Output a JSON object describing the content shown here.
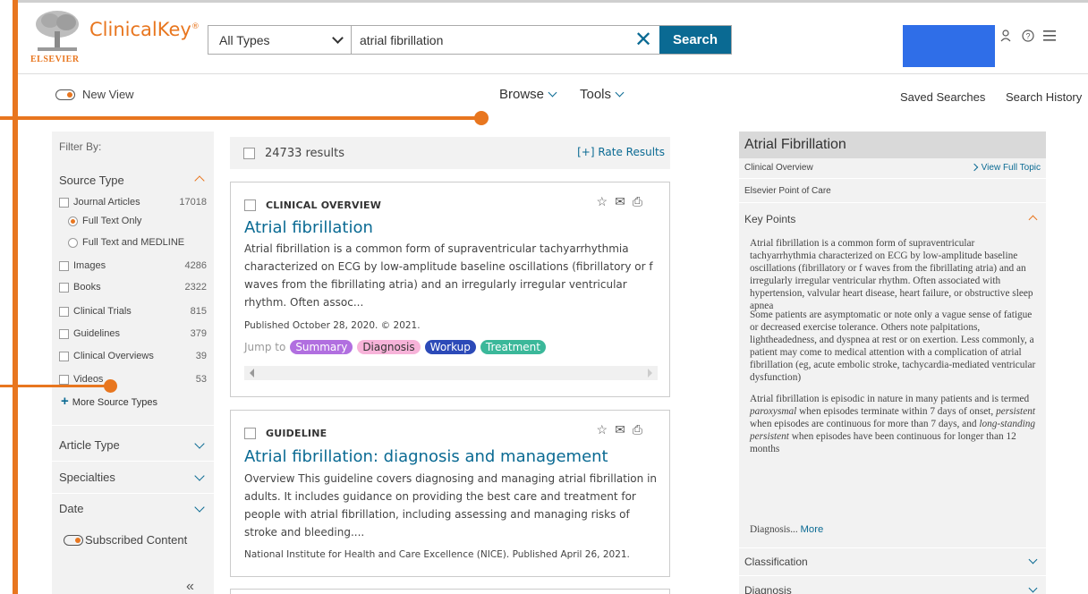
{
  "brand": {
    "name": "ClinicalKey",
    "reg": "®",
    "publisher": "ELSEVIER"
  },
  "search": {
    "type": "All Types",
    "query": "atrial fibrillation",
    "button": "Search"
  },
  "header_icons": [
    "user-icon",
    "help-icon",
    "menu-icon"
  ],
  "subnav": {
    "new_view": "New View",
    "browse": "Browse",
    "tools": "Tools",
    "saved_searches": "Saved Searches",
    "search_history": "Search History"
  },
  "filter": {
    "title": "Filter By:",
    "source_type": "Source Type",
    "items": [
      {
        "label": "Journal Articles",
        "count": "17018"
      },
      {
        "label": "Full Text Only"
      },
      {
        "label": "Full Text and MEDLINE"
      },
      {
        "label": "Images",
        "count": "4286"
      },
      {
        "label": "Books",
        "count": "2322"
      },
      {
        "label": "Clinical Trials",
        "count": "815"
      },
      {
        "label": "Guidelines",
        "count": "379"
      },
      {
        "label": "Clinical Overviews",
        "count": "39"
      },
      {
        "label": "Videos",
        "count": "53"
      }
    ],
    "more": "More Source Types",
    "article_type": "Article Type",
    "specialties": "Specialties",
    "date": "Date",
    "subscribed": "Subscribed Content",
    "collapse": "«"
  },
  "results": {
    "count": "24733 results",
    "rate": "[+] Rate Results",
    "cards": [
      {
        "kind": "CLINICAL OVERVIEW",
        "title": "Atrial fibrillation",
        "body": "Atrial fibrillation is a common form of supraventricular tachyarrhythmia characterized on ECG by low-amplitude baseline oscillations (fibrillatory or f waves from the fibrillating atria) and an irregularly irregular ventricular rhythm. Often assoc...",
        "meta": "Published October 28, 2020. © 2021.",
        "jump_label": "Jump to",
        "jumps": [
          "Summary",
          "Diagnosis",
          "Workup",
          "Treatment"
        ]
      },
      {
        "kind": "GUIDELINE",
        "title": "Atrial fibrillation: diagnosis and management",
        "body": "Overview This guideline covers diagnosing and managing atrial fibrillation in adults. It includes guidance on providing the best care and treatment for people with atrial fibrillation, including assessing and managing risks of stroke and bleeding....",
        "meta": "National Institute for Health and Care Excellence (NICE). Published April 26, 2021."
      }
    ]
  },
  "topic": {
    "title": "Atrial Fibrillation",
    "subtitle": "Clinical Overview",
    "view_full": "View Full Topic",
    "source": "Elsevier Point of Care",
    "key_points": "Key Points",
    "p1": "Atrial fibrillation is a common form of supraventricular tachyarrhythmia characterized on ECG by low-amplitude baseline oscillations (fibrillatory or f waves from the fibrillating atria) and an irregularly irregular ventricular rhythm. Often associated with hypertension, valvular heart disease, heart failure, or obstructive sleep apnea",
    "p2": "Some patients are asymptomatic or note only a vague sense of fatigue or decreased exercise tolerance. Others note palpitations, lightheadedness, and dyspnea at rest or on exertion. Less commonly, a patient may come to medical attention with a complication of atrial fibrillation (eg, acute embolic stroke, tachycardia-mediated ventricular dysfunction)",
    "p3_a": "Atrial fibrillation is episodic in nature in many patients and is termed ",
    "p3_b": "paroxysmal",
    "p3_c": " when episodes terminate within 7 days of onset, ",
    "p3_d": "persistent",
    "p3_e": " when episodes are continuous for more than 7 days, and ",
    "p3_f": "long-standing persistent",
    "p3_g": " when episodes have been continuous for longer than 12 months",
    "diag_more": "Diagnosis...",
    "more": "More",
    "classification": "Classification",
    "diagnosis": "Diagnosis"
  },
  "colors": {
    "accent": "#e8761f",
    "link": "#0a6a93",
    "highlight_box": "#2f6ee8"
  }
}
